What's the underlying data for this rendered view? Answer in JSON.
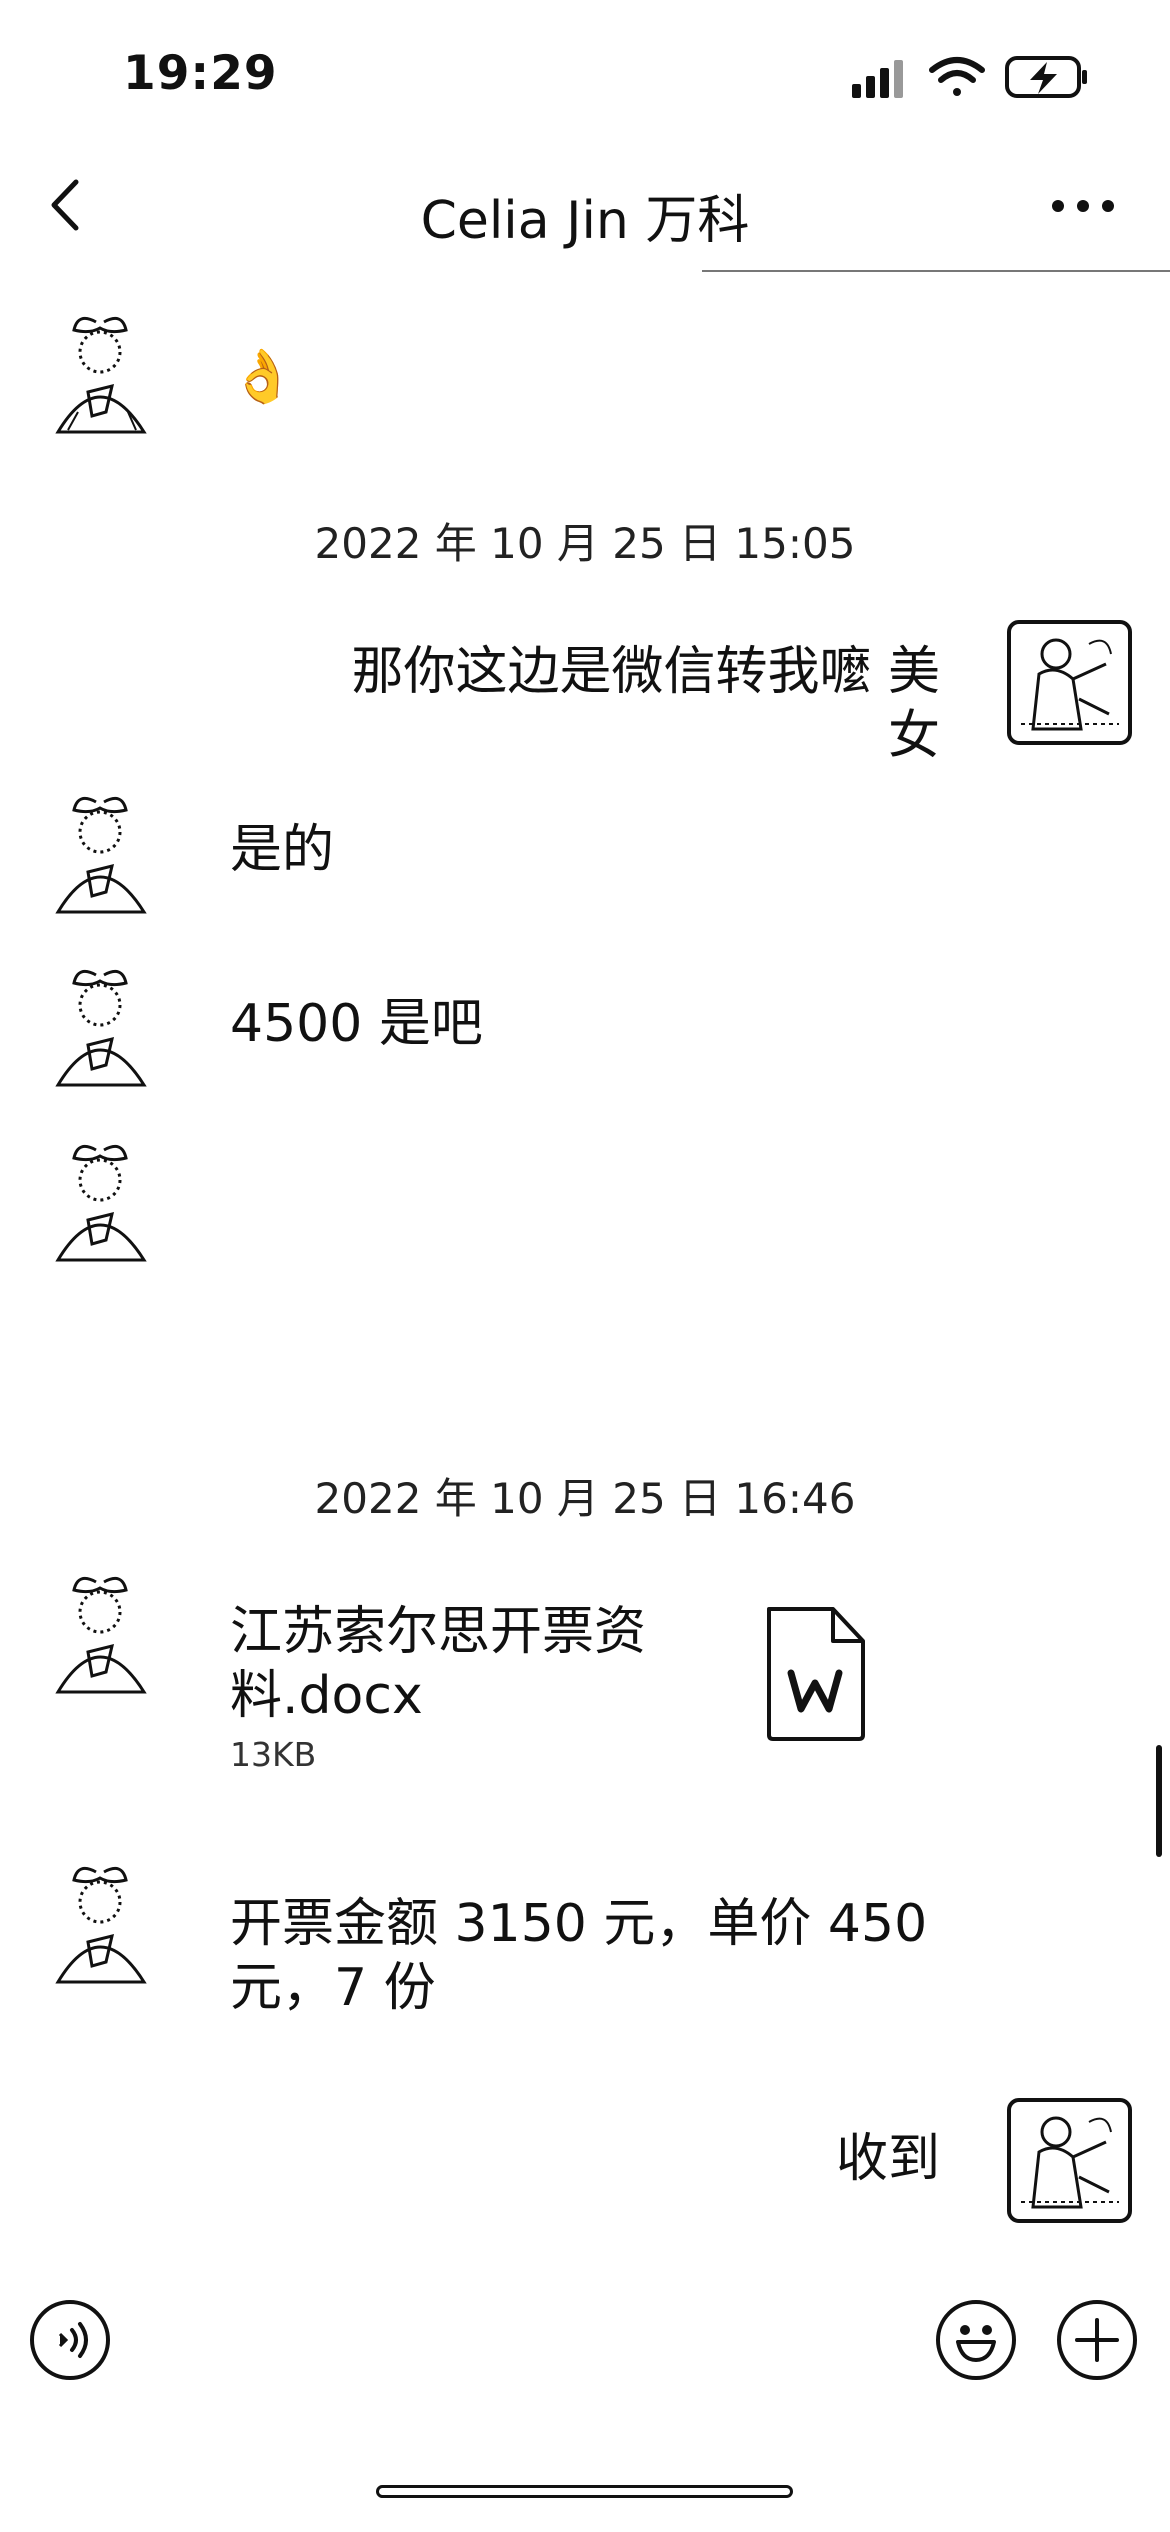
{
  "status_bar": {
    "time": "19:29"
  },
  "header": {
    "title": "Celia Jin 万科"
  },
  "messages": {
    "ok_emoji": "👌",
    "timestamp_1": "2022 年 10 月 25 日 15:05",
    "outgoing_1": "那你这边是微信转我嚒 美女",
    "incoming_1": "是的",
    "incoming_2": "4500 是吧",
    "timestamp_2": "2022 年 10 月 25 日 16:46",
    "file_name": "江苏索尔思开票资料.docx",
    "file_size": "13KB",
    "incoming_3": "开票金额 3150 元，单价 450 元，7 份",
    "outgoing_2": "收到"
  },
  "icons": {
    "back": "chevron-left-icon",
    "more": "more-icon",
    "voice": "voice-icon",
    "emoji": "emoji-icon",
    "add": "add-icon",
    "file": "word-doc-icon"
  }
}
